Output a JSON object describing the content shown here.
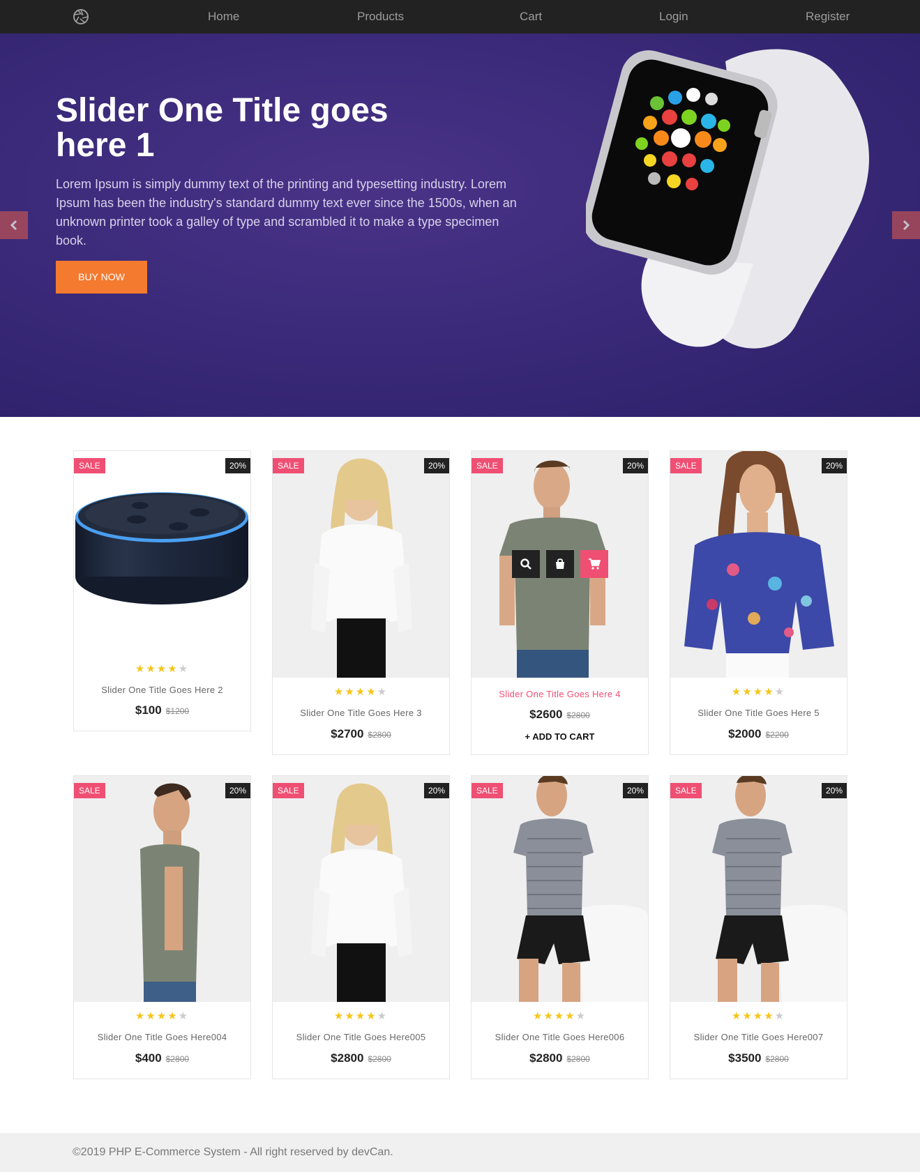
{
  "nav": {
    "home": "Home",
    "products": "Products",
    "cart": "Cart",
    "login": "Login",
    "register": "Register",
    "logo_icon": "aperture-icon"
  },
  "hero": {
    "title": "Slider One Title goes here 1",
    "text": "Lorem Ipsum is simply dummy text of the printing and typesetting industry. Lorem Ipsum has been the industry's standard dummy text ever since the 1500s, when an unknown printer took a galley of type and scrambled it to make a type specimen book.",
    "button": "BUY NOW",
    "background_color": "#3b2a7a",
    "button_color": "#f47a30"
  },
  "products": [
    {
      "title": "Slider One Title Goes Here 2",
      "price": "$100",
      "old_price": "$1200",
      "sale": "SALE",
      "discount": "20%",
      "rating": 4,
      "image": "smart-speaker"
    },
    {
      "title": "Slider One Title Goes Here 3",
      "price": "$2700",
      "old_price": "$2800",
      "sale": "SALE",
      "discount": "20%",
      "rating": 4,
      "image": "woman-white-blouse"
    },
    {
      "title": "Slider One Title Goes Here 4",
      "price": "$2600",
      "old_price": "$2800",
      "sale": "SALE",
      "discount": "20%",
      "rating": 4,
      "image": "man-green-tshirt",
      "add_to_cart": "+ ADD TO CART"
    },
    {
      "title": "Slider One Title Goes Here 5",
      "price": "$2000",
      "old_price": "$2200",
      "sale": "SALE",
      "discount": "20%",
      "rating": 4,
      "image": "woman-floral-top"
    },
    {
      "title": "Slider One Title Goes Here004",
      "price": "$400",
      "old_price": "$2800",
      "sale": "SALE",
      "discount": "20%",
      "rating": 4,
      "image": "man-side-tshirt"
    },
    {
      "title": "Slider One Title Goes Here005",
      "price": "$2800",
      "old_price": "$2800",
      "sale": "SALE",
      "discount": "20%",
      "rating": 4,
      "image": "woman-white-blouse"
    },
    {
      "title": "Slider One Title Goes Here006",
      "price": "$2800",
      "old_price": "$2800",
      "sale": "SALE",
      "discount": "20%",
      "rating": 4,
      "image": "man-striped-tshirt"
    },
    {
      "title": "Slider One Title Goes Here007",
      "price": "$3500",
      "old_price": "$2800",
      "sale": "SALE",
      "discount": "20%",
      "rating": 4,
      "image": "man-striped-tshirt"
    }
  ],
  "colors": {
    "sale_badge": "#ef4f73",
    "star": "#f5c518",
    "navbar": "#222222"
  },
  "footer": {
    "text": "©2019 PHP E-Commerce System - All right reserved by devCan."
  }
}
